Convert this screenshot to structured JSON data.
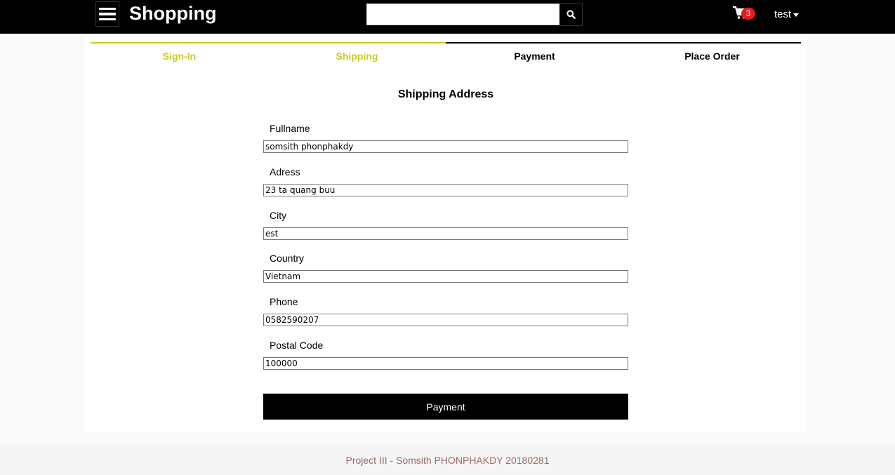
{
  "header": {
    "brand": "Shopping",
    "search": {
      "placeholder": "",
      "value": ""
    },
    "cart": {
      "count": "3"
    },
    "user": {
      "name": "test"
    }
  },
  "steps": [
    {
      "label": "Sign-In",
      "state": "done"
    },
    {
      "label": "Shipping",
      "state": "done"
    },
    {
      "label": "Payment",
      "state": "pending"
    },
    {
      "label": "Place Order",
      "state": "pending"
    }
  ],
  "form": {
    "title": "Shipping Address",
    "fields": [
      {
        "label": "Fullname",
        "value": "somsith phonphakdy"
      },
      {
        "label": "Adress",
        "value": "23 ta quang buu"
      },
      {
        "label": "City",
        "value": "est"
      },
      {
        "label": "Country",
        "value": "Vietnam"
      },
      {
        "label": "Phone",
        "value": "0582590207"
      },
      {
        "label": "Postal Code",
        "value": "100000"
      }
    ],
    "submit_label": "Payment"
  },
  "footer": {
    "text": "Project III - Somsith PHONPHAKDY 20180281"
  },
  "colors": {
    "accent": "#c8cc1e",
    "badge": "#e31b1b",
    "footer_text": "#9b6b6b"
  }
}
